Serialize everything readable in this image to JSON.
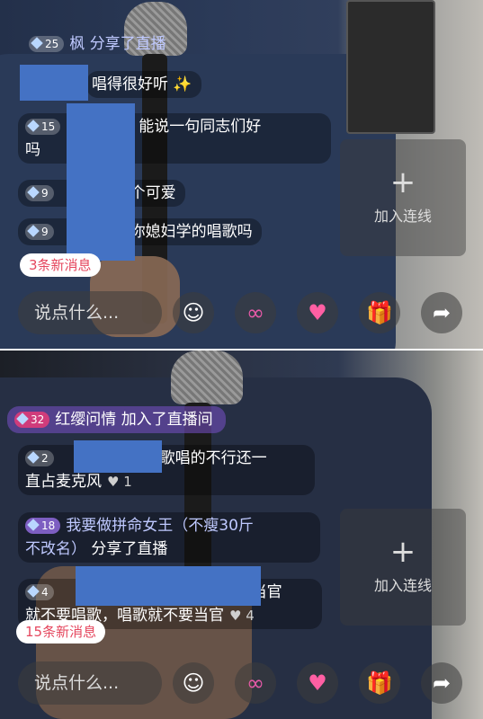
{
  "panel_top": {
    "messages": [
      {
        "badge": "25",
        "name": "枫",
        "text": "分享了直播"
      },
      {
        "badge": "",
        "name": "",
        "text": "唱得很好听"
      },
      {
        "badge": "15",
        "name": "",
        "text": "：能说一句同志们好"
      },
      {
        "badge": "",
        "name": "",
        "text": "吗"
      },
      {
        "badge": "9",
        "name": "",
        "text": "这个可爱"
      },
      {
        "badge": "9",
        "name": "",
        "text": "跟你媳妇学的唱歌吗"
      }
    ],
    "new_messages": "3条新消息",
    "input_placeholder": "说点什么...",
    "link_mic": {
      "plus": "+",
      "label": "加入连线"
    }
  },
  "panel_bottom": {
    "messages": [
      {
        "badge": "32",
        "name": "红缨问情",
        "text": "加入了直播间"
      },
      {
        "badge": "2",
        "name": "",
        "text": "歌唱的不行还一"
      },
      {
        "badge": "",
        "name": "",
        "text": "直占麦克风",
        "likes": "1"
      },
      {
        "badge": "18",
        "name": "我要做拼命女王（不瘦30斤",
        "text": ""
      },
      {
        "badge": "",
        "name": "不改名）",
        "text": "分享了直播"
      },
      {
        "badge": "4",
        "name": "",
        "text": "当官"
      },
      {
        "badge": "",
        "name": "",
        "text": "就不要唱歌，唱歌就不要当官",
        "likes": "4"
      }
    ],
    "new_messages": "15条新消息",
    "input_placeholder": "说点什么...",
    "link_mic": {
      "plus": "+",
      "label": "加入连线"
    }
  },
  "icons": [
    "smile-icon",
    "link-icon",
    "heart-icon",
    "gift-icon",
    "share-icon"
  ]
}
